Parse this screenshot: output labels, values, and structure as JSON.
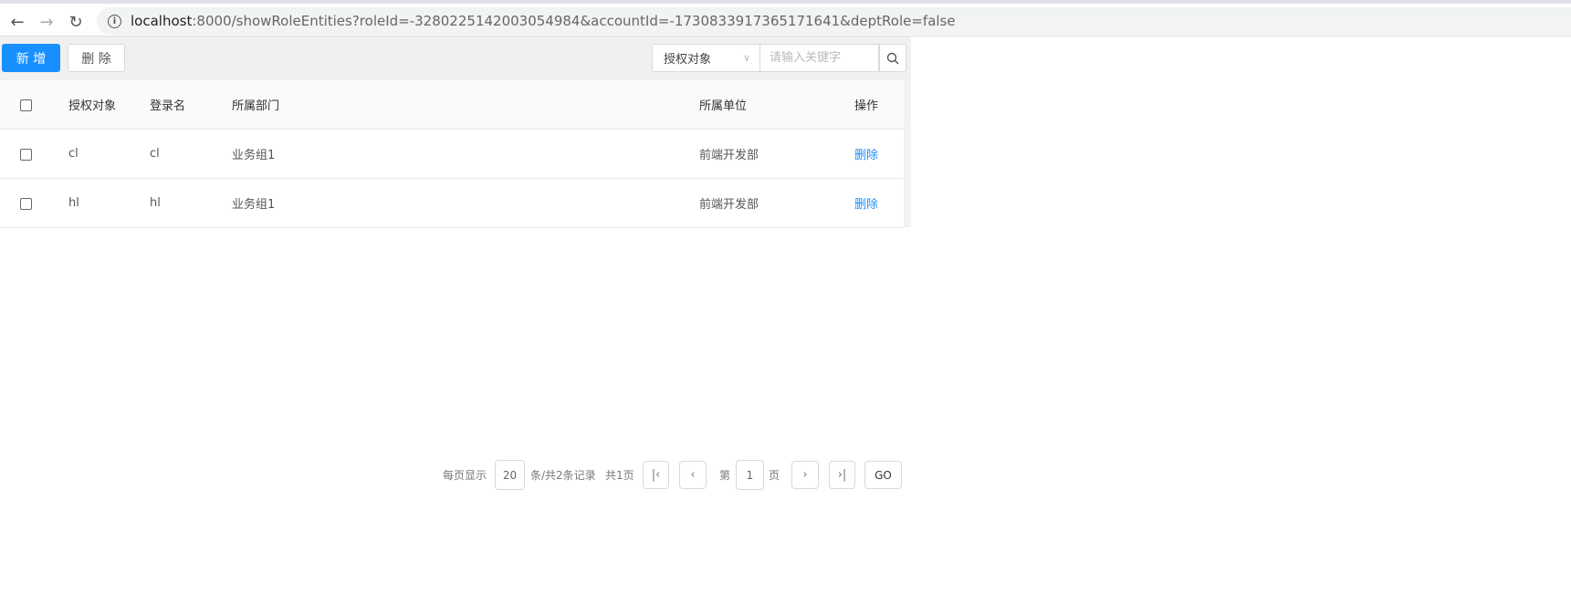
{
  "browser": {
    "url_host": "localhost",
    "url_rest": ":8000/showRoleEntities?roleId=-3280225142003054984&accountId=-1730833917365171641&deptRole=false"
  },
  "toolbar": {
    "add_label": "新 增",
    "delete_label": "删 除",
    "filter_select": "授权对象",
    "search_placeholder": "请输入关键字"
  },
  "table": {
    "headers": [
      "授权对象",
      "登录名",
      "所属部门",
      "所属单位",
      "操作"
    ],
    "rows": [
      {
        "subject": "cl",
        "login": "cl",
        "dept": "业务组1",
        "unit": "前端开发部",
        "action": "删除"
      },
      {
        "subject": "hl",
        "login": "hl",
        "dept": "业务组1",
        "unit": "前端开发部",
        "action": "删除"
      }
    ]
  },
  "pagination": {
    "per_page_label": "每页显示",
    "per_page": "20",
    "total_label": "条/共2条记录",
    "pages_label": "共1页",
    "page_prefix": "第",
    "page": "1",
    "page_suffix": "页",
    "go_label": "GO"
  },
  "colors": {
    "accent": "#1890ff"
  }
}
